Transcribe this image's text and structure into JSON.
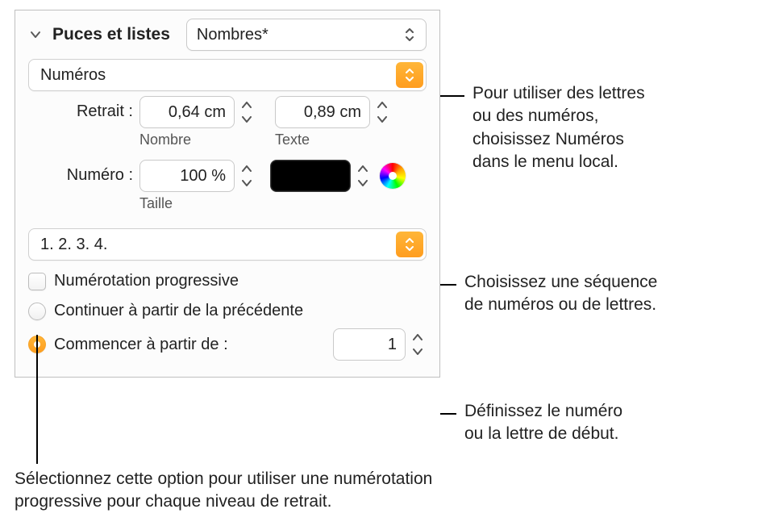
{
  "section": {
    "title": "Puces et listes",
    "style_popup_value": "Nombres*"
  },
  "type_popup": "Numéros",
  "indent": {
    "label": "Retrait :",
    "number_value": "0,64 cm",
    "number_sublabel": "Nombre",
    "text_value": "0,89 cm",
    "text_sublabel": "Texte"
  },
  "numero": {
    "label": "Numéro :",
    "size_value": "100 %",
    "size_sublabel": "Taille"
  },
  "sequence_value": "1. 2. 3. 4.",
  "progressive_checkbox_label": "Numérotation progressive",
  "radio": {
    "continue_label": "Continuer à partir de la précédente",
    "startfrom_label": "Commencer à partir de :",
    "startfrom_value": "1"
  },
  "annotations": {
    "a1": "Pour utiliser des lettres\nou des numéros,\nchoisissez Numéros\ndans le menu local.",
    "a2": "Choisissez une séquence\nde numéros ou de lettres.",
    "a3": "Définissez le numéro\nou la lettre de début.",
    "a4": "Sélectionnez cette option pour utiliser une numérotation\nprogressive pour chaque niveau de retrait."
  }
}
